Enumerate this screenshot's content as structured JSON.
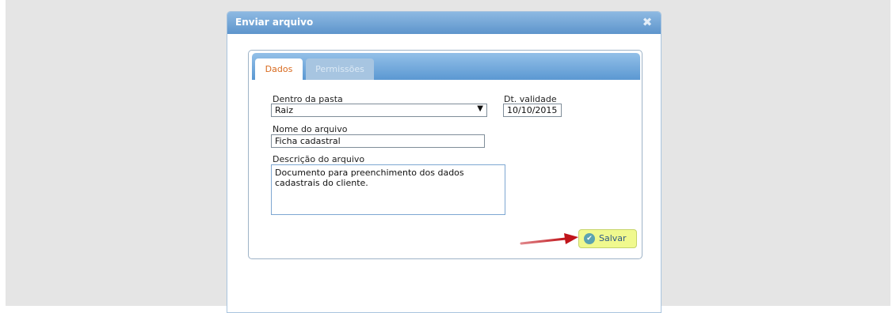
{
  "dialog": {
    "title": "Enviar arquivo",
    "close_glyph": "✖",
    "tabs": [
      {
        "label": "Dados",
        "active": true
      },
      {
        "label": "Permissões",
        "active": false
      }
    ]
  },
  "form": {
    "folder": {
      "label": "Dentro da pasta",
      "value": "Raiz",
      "arrow": "▼"
    },
    "validity": {
      "label": "Dt. validade",
      "value": "10/10/2015"
    },
    "file_name": {
      "label": "Nome do arquivo",
      "value": "Ficha cadastral"
    },
    "description": {
      "label": "Descrição do arquivo",
      "value": "Documento para preenchimento dos dados cadastrais do cliente."
    },
    "save": {
      "label": "Salvar",
      "icon": "check-circle-icon",
      "glyph": "✔"
    }
  },
  "colors": {
    "titlebar": "#6fa3d6",
    "active_tab_text": "#d86a1f",
    "save_button": "#f0f98e",
    "arrow": "#c0141a"
  }
}
